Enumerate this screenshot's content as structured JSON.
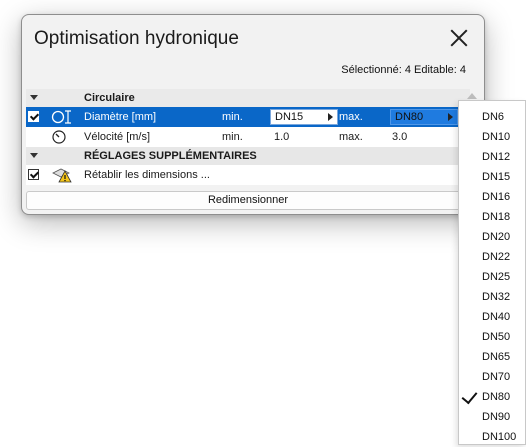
{
  "dialog": {
    "title": "Optimisation hydronique",
    "selection_info": "Sélectionné: 4 Editable: 4",
    "resize_button": "Redimensionner"
  },
  "groups": {
    "circular": "Circulaire",
    "extra": "RÉGLAGES SUPPLÉMENTAIRES"
  },
  "rows": {
    "diameter": {
      "checked": true,
      "label": "Diamètre [mm]",
      "min_label": "min.",
      "min_value": "DN15",
      "max_label": "max.",
      "max_value": "DN80"
    },
    "velocity": {
      "label": "Vélocité [m/s]",
      "min_label": "min.",
      "min_value": "1.0",
      "max_label": "max.",
      "max_value": "3.0"
    },
    "restore": {
      "checked": true,
      "label": "Rétablir les dimensions ..."
    }
  },
  "dropdown": {
    "options": [
      "DN6",
      "DN10",
      "DN12",
      "DN15",
      "DN16",
      "DN18",
      "DN20",
      "DN22",
      "DN25",
      "DN32",
      "DN40",
      "DN50",
      "DN65",
      "DN70",
      "DN80",
      "DN90",
      "DN100"
    ],
    "selected": "DN80"
  },
  "colors": {
    "selection": "#0a67c8",
    "dialog_bg": "#f2f2f2"
  }
}
